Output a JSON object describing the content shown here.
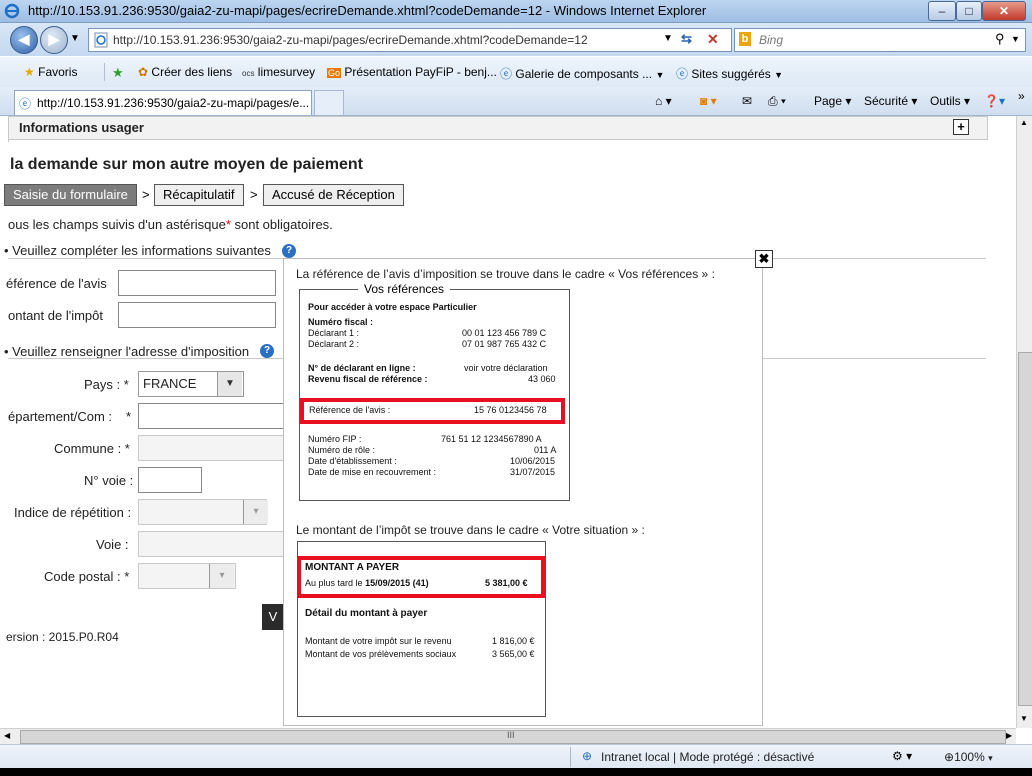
{
  "window": {
    "title": "http://10.153.91.236:9530/gaia2-zu-mapi/pages/ecrireDemande.xhtml?codeDemande=12 - Windows Internet Explorer",
    "min": "–",
    "max": "□",
    "close": "✕"
  },
  "address": {
    "url": "http://10.153.91.236:9530/gaia2-zu-mapi/pages/ecrireDemande.xhtml?codeDemande=12",
    "search_placeholder": "Bing"
  },
  "favorites": {
    "label": "Favoris",
    "items": [
      "Créer des liens",
      "limesurvey",
      "Présentation PayFiP - benj...",
      "Galerie de composants ...",
      "Sites suggérés"
    ]
  },
  "tabs": {
    "active_label": "http://10.153.91.236:9530/gaia2-zu-mapi/pages/e..."
  },
  "toolbar": {
    "page": "Page",
    "security": "Sécurité",
    "tools": "Outils"
  },
  "page": {
    "info_header": "Informations usager",
    "title": "la demande sur mon autre moyen de paiement",
    "steps": [
      "Saisie du formulaire",
      "Récapitulatif",
      "Accusé de Réception"
    ],
    "step_sep": ">",
    "required_note_before": "ous les champs suivis d'un astérisque",
    "required_star": "*",
    "required_note_after": " sont obligatoires.",
    "section1": "Veuillez compléter les informations suivantes",
    "ref_label": "éférence de l'avis",
    "montant_label": "ontant de l'impôt",
    "section2": "Veuillez renseigner l'adresse d'imposition",
    "pays_label": "Pays : *",
    "pays_value": "FRANCE",
    "dept_label": "épartement/Com :",
    "commune_label": "Commune : *",
    "voie_num_label": "N° voie :",
    "indice_label": "Indice de répétition :",
    "voie_label": "Voie :",
    "cp_label": "Code postal : *",
    "star": "*",
    "version": "ersion : 2015.P0.R04",
    "cut_button": "V"
  },
  "popup": {
    "close": "✖",
    "text1": "La référence de l’avis d’imposition se trouve dans le cadre « Vos références » :",
    "text2": "Le montant de l’impôt se trouve dans le cadre « Votre situation » :",
    "refcard": {
      "title": "Vos références",
      "heading": "Pour accéder à votre espace Particulier",
      "numero_fiscal": "Numéro fiscal :",
      "declarant1": "Déclarant 1 :",
      "declarant1_val": "00 01 123 456 789 C",
      "declarant2": "Déclarant 2 :",
      "declarant2_val": "07 01 987 765 432 C",
      "num_ligne": "N° de déclarant en ligne :",
      "num_ligne_val": "voir votre déclaration",
      "revenu": "Revenu fiscal de référence :",
      "revenu_val": "43 060",
      "ref_avis": "Référence de l'avis :",
      "ref_avis_val": "15 76 0123456 78",
      "fip": "Numéro FIP :",
      "fip_val": "761 51 12 1234567890 A",
      "role": "Numéro de rôle :",
      "role_val": "011 A",
      "date_etab": "Date d'établissement :",
      "date_etab_val": "10/06/2015",
      "date_recouv": "Date de mise en recouvrement :",
      "date_recouv_val": "31/07/2015"
    },
    "situationcard": {
      "montant_a_payer": "MONTANT A PAYER",
      "au_plus_tard": "Au plus tard le",
      "date": "15/09/2015 (41)",
      "total": "5 381,00 €",
      "detail": "Détail du montant à payer",
      "impot_label": "Montant de votre impôt sur le revenu",
      "impot_val": "1 816,00 €",
      "prelev_label": "Montant de vos prélèvements sociaux",
      "prelev_val": "3 565,00 €"
    }
  },
  "statusbar": {
    "zone": "Intranet local | Mode protégé : désactivé",
    "zoom": "100%"
  },
  "scroll": {
    "hscroll_mid": "III"
  }
}
